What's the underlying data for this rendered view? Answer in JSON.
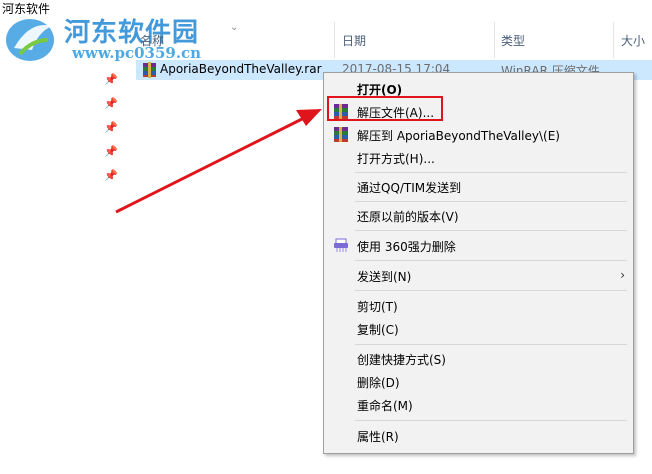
{
  "window": {
    "title": "河东软件"
  },
  "watermark": {
    "name": "河东软件园",
    "url": "www.pc0359.cn"
  },
  "columns": {
    "name": "名称",
    "date": "日期",
    "type": "类型",
    "size": "大小"
  },
  "file": {
    "name": "AporiaBeyondTheValley.rar",
    "date": "2017-08-15 17:04",
    "type": "WinRAR 压缩文件"
  },
  "context_menu": {
    "items": [
      {
        "label": "打开(O)"
      },
      {
        "label": "解压文件(A)..."
      },
      {
        "label": "解压到 AporiaBeyondTheValley\\(E)"
      },
      {
        "label": "打开方式(H)..."
      },
      {
        "label": "通过QQ/TIM发送到"
      },
      {
        "label": "还原以前的版本(V)"
      },
      {
        "label": "使用 360强力删除"
      },
      {
        "label": "发送到(N)"
      },
      {
        "label": "剪切(T)"
      },
      {
        "label": "复制(C)"
      },
      {
        "label": "创建快捷方式(S)"
      },
      {
        "label": "删除(D)"
      },
      {
        "label": "重命名(M)"
      },
      {
        "label": "属性(R)"
      }
    ]
  },
  "annotation": {
    "color": "#e0141b"
  }
}
